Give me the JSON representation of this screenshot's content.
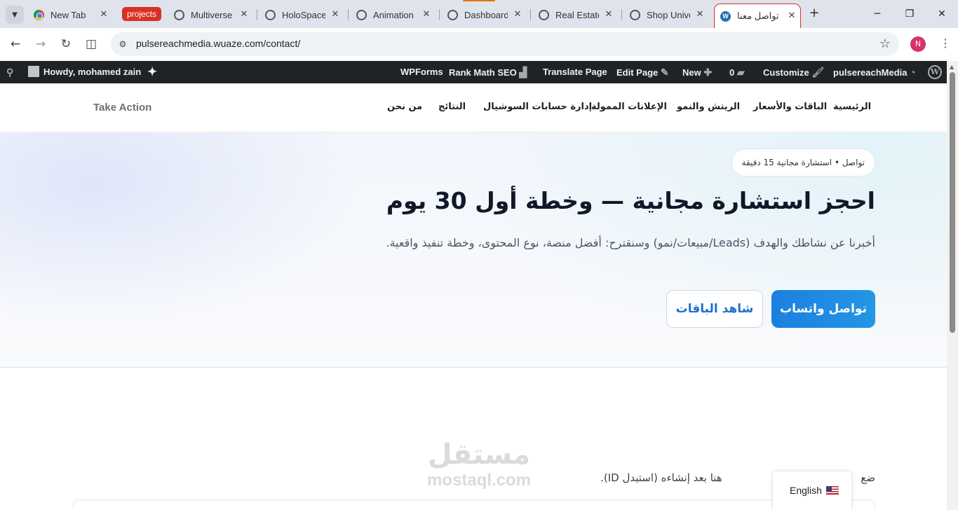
{
  "browser": {
    "tabs": [
      {
        "label": "New Tab",
        "favicon": "chrome-icon"
      },
      {
        "label": "Multiverse",
        "favicon": "globe-icon"
      },
      {
        "label": "HoloSpace",
        "favicon": "globe-icon"
      },
      {
        "label": "Animation",
        "favicon": "globe-icon"
      },
      {
        "label": "Dashboard",
        "favicon": "globe-icon"
      },
      {
        "label": "Real Estate",
        "favicon": "globe-icon"
      },
      {
        "label": "Shop Unive",
        "favicon": "globe-icon"
      },
      {
        "label": "تواصل معنا",
        "favicon": "wordpress-icon",
        "active": true
      }
    ],
    "group_label": "projects",
    "group_color": "#d93025",
    "url": "pulsereachmedia.wuaze.com/contact/",
    "profile_initial": "N"
  },
  "adminbar": {
    "greeting": "Howdy, mohamed zain",
    "wpforms": "WPForms",
    "rankmath": "Rank Math SEO",
    "translate": "Translate Page",
    "edit_page": "Edit Page",
    "new": "New",
    "comments_count": "0",
    "customize": "Customize",
    "site_name": "pulsereachMedia"
  },
  "header": {
    "menu": [
      "الرئيسية",
      "الباقات والأسعار",
      "الريتش والنمو",
      "الإعلانات الممولة",
      "إدارة حسابات السوشيال",
      "النتائج",
      "من نحن"
    ],
    "cta": "Take Action"
  },
  "hero": {
    "eyebrow": "تواصل • استشارة مجانية 15 دقيقة",
    "title": "احجز استشارة مجانية — وخطة أول 30 يوم",
    "subtitle": "أخبرنا عن نشاطك والهدف (Leads/مبيعات/نمو) وسنقترح: أفضل منصة، نوع المحتوى، وخطة تنفيذ واقعية.",
    "primary_button": "تواصل واتساب",
    "secondary_button": "شاهد الباقات"
  },
  "form": {
    "hint_start": "ضع",
    "hint_end": "هنا بعد إنشاءه (استبدل ID)."
  },
  "language_switcher": {
    "label": "English"
  },
  "watermark": {
    "arabic": "مستقل",
    "latin": "mostaql.com"
  },
  "colors": {
    "primary": "#1c7fe0",
    "adminbar": "#1d2327"
  }
}
